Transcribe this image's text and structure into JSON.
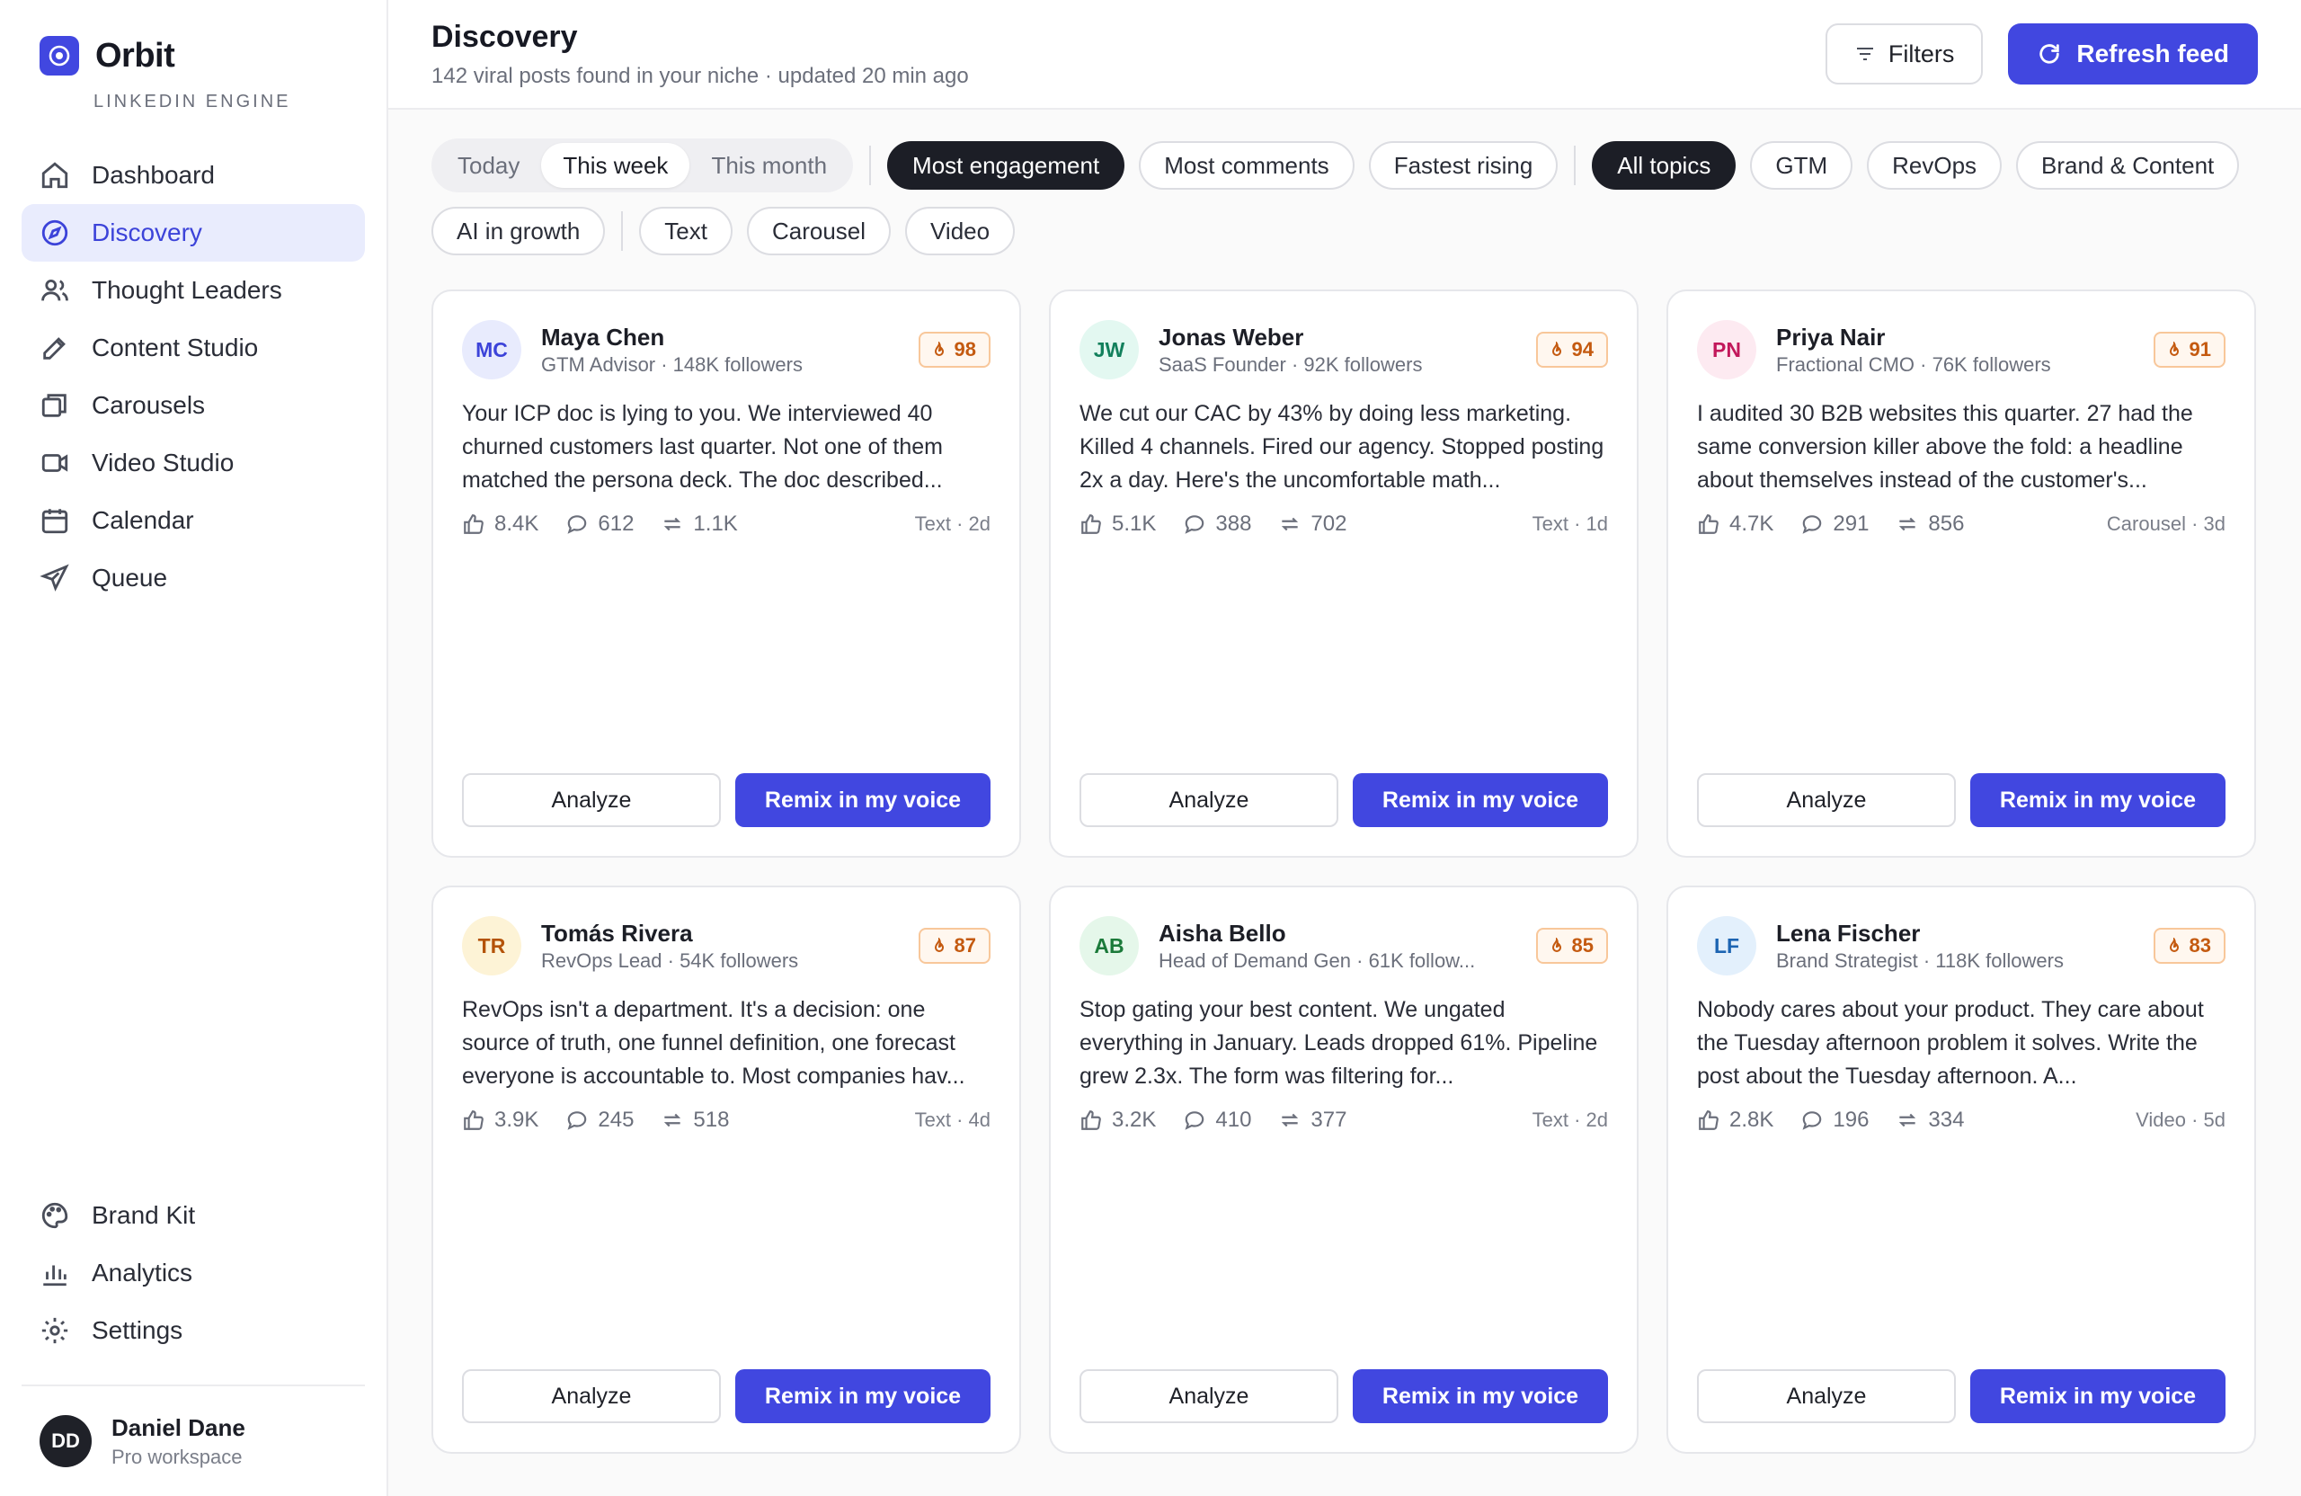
{
  "brand": {
    "name": "Orbit",
    "subtitle": "LINKEDIN ENGINE",
    "accent": "#4147e0"
  },
  "nav": {
    "items": [
      {
        "label": "Dashboard",
        "icon": "home-icon"
      },
      {
        "label": "Discovery",
        "icon": "compass-icon",
        "active": true
      },
      {
        "label": "Thought Leaders",
        "icon": "users-icon"
      },
      {
        "label": "Content Studio",
        "icon": "pencil-icon"
      },
      {
        "label": "Carousels",
        "icon": "layers-icon"
      },
      {
        "label": "Video Studio",
        "icon": "video-icon"
      },
      {
        "label": "Calendar",
        "icon": "calendar-icon"
      },
      {
        "label": "Queue",
        "icon": "send-icon"
      }
    ],
    "bottom": [
      {
        "label": "Brand Kit",
        "icon": "palette-icon"
      },
      {
        "label": "Analytics",
        "icon": "bar-chart-icon"
      },
      {
        "label": "Settings",
        "icon": "gear-icon"
      }
    ]
  },
  "user": {
    "initials": "DD",
    "name": "Daniel Dane",
    "plan": "Pro workspace"
  },
  "header": {
    "title": "Discovery",
    "subtitle": "142 viral posts found in your niche · updated 20 min ago",
    "filters_label": "Filters",
    "refresh_label": "Refresh feed"
  },
  "filters": {
    "range": [
      "Today",
      "This week",
      "This month"
    ],
    "range_active": "This week",
    "sort": [
      "Most engagement",
      "Most comments",
      "Fastest rising"
    ],
    "sort_active": "Most engagement",
    "topics": [
      "All topics",
      "GTM",
      "RevOps",
      "Brand & Content",
      "AI in growth"
    ],
    "topics_active": "All topics",
    "formats": [
      "Text",
      "Carousel",
      "Video"
    ]
  },
  "posts": [
    {
      "initials": "MC",
      "avatar_bg": "#e8ebfd",
      "avatar_fg": "#3c43d9",
      "name": "Maya Chen",
      "meta": "GTM Advisor · 148K followers",
      "score": "98",
      "text": "Your ICP doc is lying to you. We interviewed 40 churned customers last quarter. Not one of them matched the persona deck. The doc described...",
      "likes": "8.4K",
      "comments": "612",
      "reposts": "1.1K",
      "format": "Text · 2d"
    },
    {
      "initials": "JW",
      "avatar_bg": "#e3f8f1",
      "avatar_fg": "#12805c",
      "name": "Jonas Weber",
      "meta": "SaaS Founder · 92K followers",
      "score": "94",
      "text": "We cut our CAC by 43% by doing less marketing. Killed 4 channels. Fired our agency. Stopped posting 2x a day. Here's the uncomfortable math...",
      "likes": "5.1K",
      "comments": "388",
      "reposts": "702",
      "format": "Text · 1d"
    },
    {
      "initials": "PN",
      "avatar_bg": "#fdeaf1",
      "avatar_fg": "#c2185b",
      "name": "Priya Nair",
      "meta": "Fractional CMO · 76K followers",
      "score": "91",
      "text": "I audited 30 B2B websites this quarter. 27 had the same conversion killer above the fold: a headline about themselves instead of the customer's...",
      "likes": "4.7K",
      "comments": "291",
      "reposts": "856",
      "format": "Carousel · 3d"
    },
    {
      "initials": "TR",
      "avatar_bg": "#fdf3d6",
      "avatar_fg": "#b45309",
      "name": "Tomás Rivera",
      "meta": "RevOps Lead · 54K followers",
      "score": "87",
      "text": "RevOps isn't a department. It's a decision: one source of truth, one funnel definition, one forecast everyone is accountable to. Most companies hav...",
      "likes": "3.9K",
      "comments": "245",
      "reposts": "518",
      "format": "Text · 4d"
    },
    {
      "initials": "AB",
      "avatar_bg": "#e5f7ea",
      "avatar_fg": "#1b7a3a",
      "name": "Aisha Bello",
      "meta": "Head of Demand Gen · 61K follow...",
      "score": "85",
      "text": "Stop gating your best content. We ungated everything in January. Leads dropped 61%. Pipeline grew 2.3x. The form was filtering for...",
      "likes": "3.2K",
      "comments": "410",
      "reposts": "377",
      "format": "Text · 2d"
    },
    {
      "initials": "LF",
      "avatar_bg": "#e3f0fc",
      "avatar_fg": "#1c64b2",
      "name": "Lena Fischer",
      "meta": "Brand Strategist · 118K followers",
      "score": "83",
      "text": "Nobody cares about your product. They care about the Tuesday afternoon problem it solves. Write the post about the Tuesday afternoon. A...",
      "likes": "2.8K",
      "comments": "196",
      "reposts": "334",
      "format": "Video · 5d"
    }
  ],
  "card_actions": {
    "analyze_label": "Analyze",
    "remix_label": "Remix in my voice"
  }
}
